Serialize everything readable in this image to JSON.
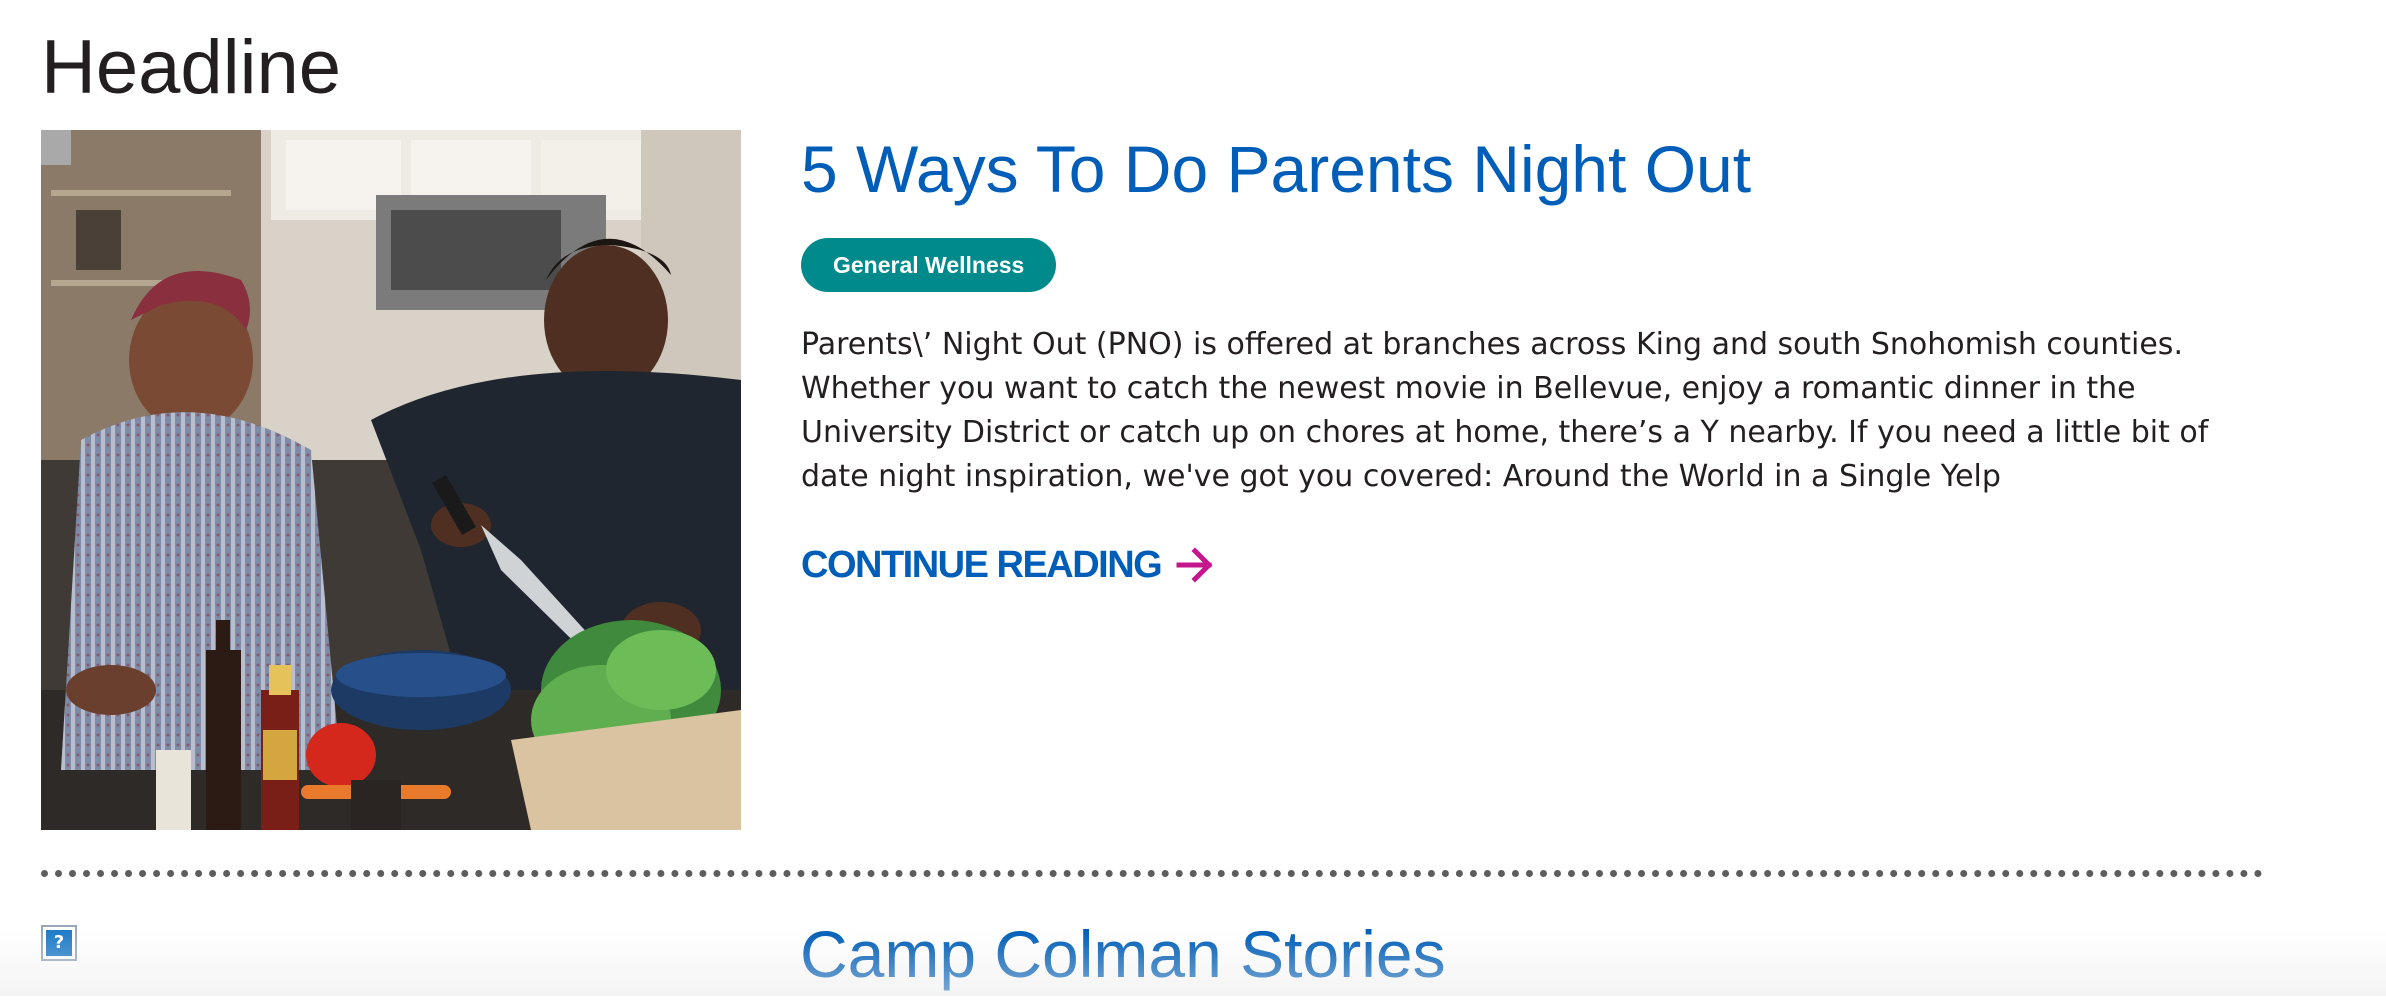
{
  "page": {
    "heading": "Headline"
  },
  "article": {
    "image_alt": "Two people laughing and cooking together in a kitchen",
    "title": "5 Ways To Do Parents Night Out",
    "category": "General Wellness",
    "excerpt": "Parents\\’ Night Out (PNO) is offered at branches across King and south Snohomish counties. Whether you want to catch the newest movie in Bellevue, enjoy a romantic dinner in the University District or catch up on chores at home, there’s a Y nearby. If you need a little bit of date night inspiration, we've got you covered: Around the World in a Single Yelp",
    "continue_label": "CONTINUE READING",
    "continue_icon": "arrow-right-icon"
  },
  "next_article": {
    "image_icon": "broken-image-icon",
    "image_glyph": "?",
    "title": "Camp Colman Stories"
  },
  "colors": {
    "link_blue": "#005eb8",
    "pill_teal": "#008a8c",
    "arrow_magenta": "#c6168d",
    "text_dark": "#231f20"
  }
}
